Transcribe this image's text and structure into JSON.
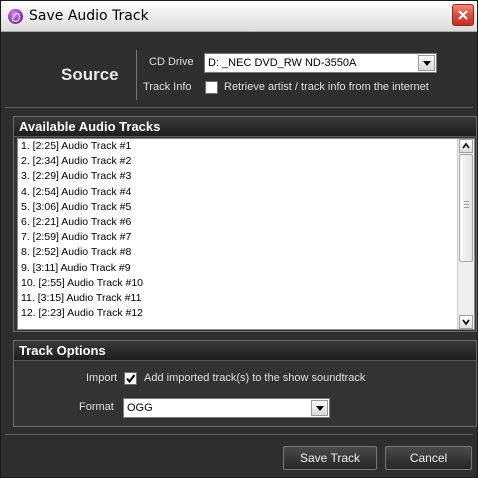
{
  "window": {
    "title": "Save Audio Track"
  },
  "source": {
    "heading": "Source",
    "cd_drive_label": "CD Drive",
    "cd_drive_value": "D:  _NEC DVD_RW ND-3550A",
    "track_info_label": "Track Info",
    "track_info_checked": false,
    "track_info_text": "Retrieve artist / track info from the internet"
  },
  "tracks": {
    "heading": "Available Audio Tracks",
    "items": [
      "1. [2:25] Audio Track #1",
      "2. [2:34] Audio Track #2",
      "3. [2:29] Audio Track #3",
      "4. [2:54] Audio Track #4",
      "5. [3:06] Audio Track #5",
      "6. [2:21] Audio Track #6",
      "7. [2:59] Audio Track #7",
      "8. [2:52] Audio Track #8",
      "9. [3:11] Audio Track #9",
      "10. [2:55] Audio Track #10",
      "11. [3:15] Audio Track #11",
      "12. [2:23] Audio Track #12"
    ]
  },
  "options": {
    "heading": "Track Options",
    "import_label": "Import",
    "import_checked": true,
    "import_text": "Add imported track(s) to the show soundtrack",
    "format_label": "Format",
    "format_value": "OGG"
  },
  "buttons": {
    "save": "Save Track",
    "cancel": "Cancel"
  },
  "icons": {
    "app": "audio-disc-icon",
    "close": "close-icon",
    "dropdown": "chevron-down-icon",
    "scroll_up": "scroll-up-arrow-icon",
    "scroll_down": "scroll-down-arrow-icon"
  }
}
